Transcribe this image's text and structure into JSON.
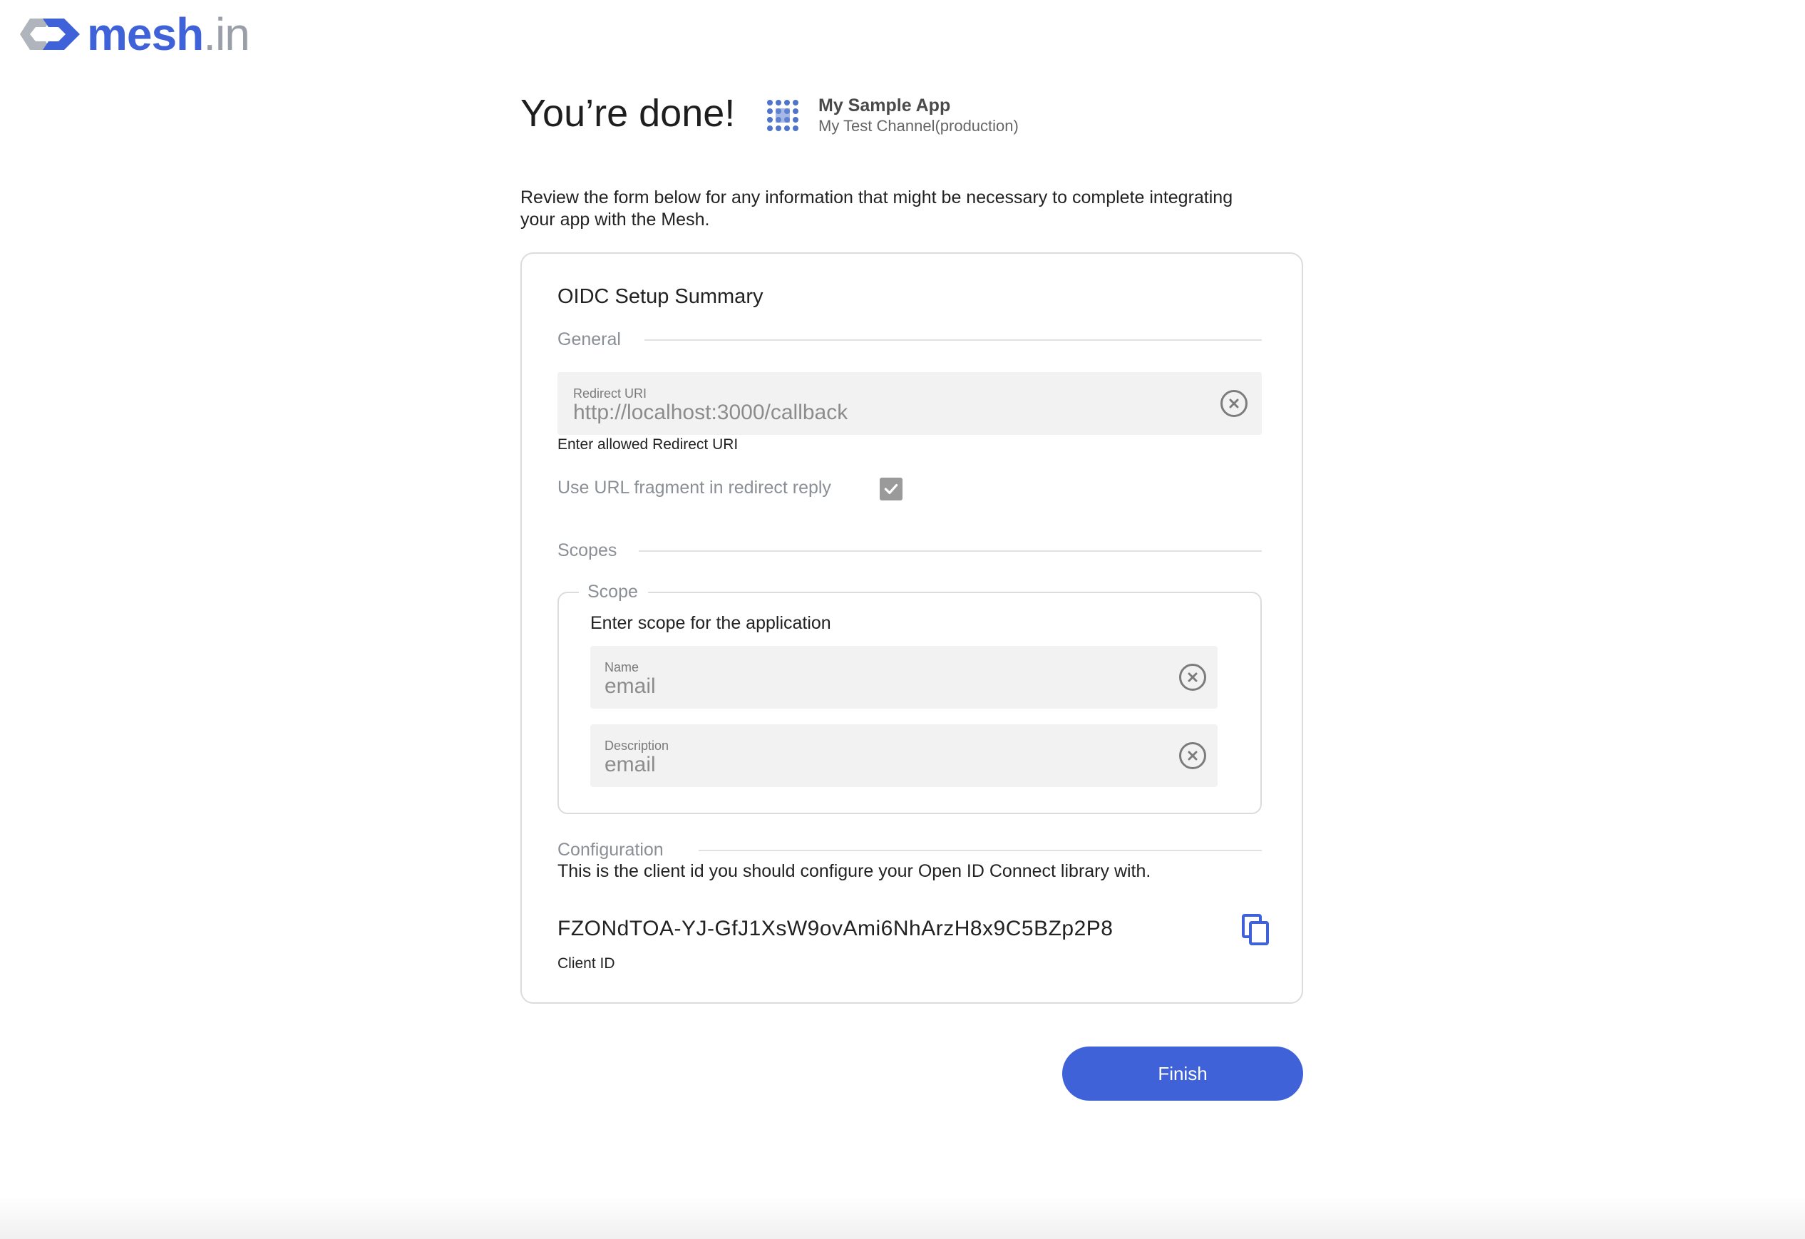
{
  "brand": {
    "name_part1": "mesh",
    "name_part2": ".in",
    "colors": {
      "primary": "#3f62d8",
      "secondary": "#9a9ea8"
    }
  },
  "header": {
    "title": "You’re done!",
    "app_name": "My Sample App",
    "app_channel": "My Test Channel(production)",
    "app_icon": "grid-dots-icon"
  },
  "intro": "Review the form below for any information that might be necessary to complete integrating your app with the Mesh.",
  "card": {
    "title": "OIDC Setup Summary",
    "general": {
      "label": "General",
      "redirect_uri": {
        "label": "Redirect URI",
        "value": "http://localhost:3000/callback",
        "helper": "Enter allowed Redirect URI"
      },
      "url_fragment": {
        "label": "Use URL fragment in redirect reply",
        "checked": true
      }
    },
    "scopes": {
      "label": "Scopes",
      "scope_legend": "Scope",
      "scope_hint": "Enter scope for the application",
      "name": {
        "label": "Name",
        "value": "email"
      },
      "description": {
        "label": "Description",
        "value": "email"
      }
    },
    "configuration": {
      "label": "Configuration",
      "text": "This is the client id you should configure your Open ID Connect library with.",
      "client_id": "FZONdTOA-YJ-GfJ1XsW9ovAmi6NhArzH8x9C5BZp2P8",
      "client_id_label": "Client ID"
    }
  },
  "actions": {
    "finish_label": "Finish"
  }
}
